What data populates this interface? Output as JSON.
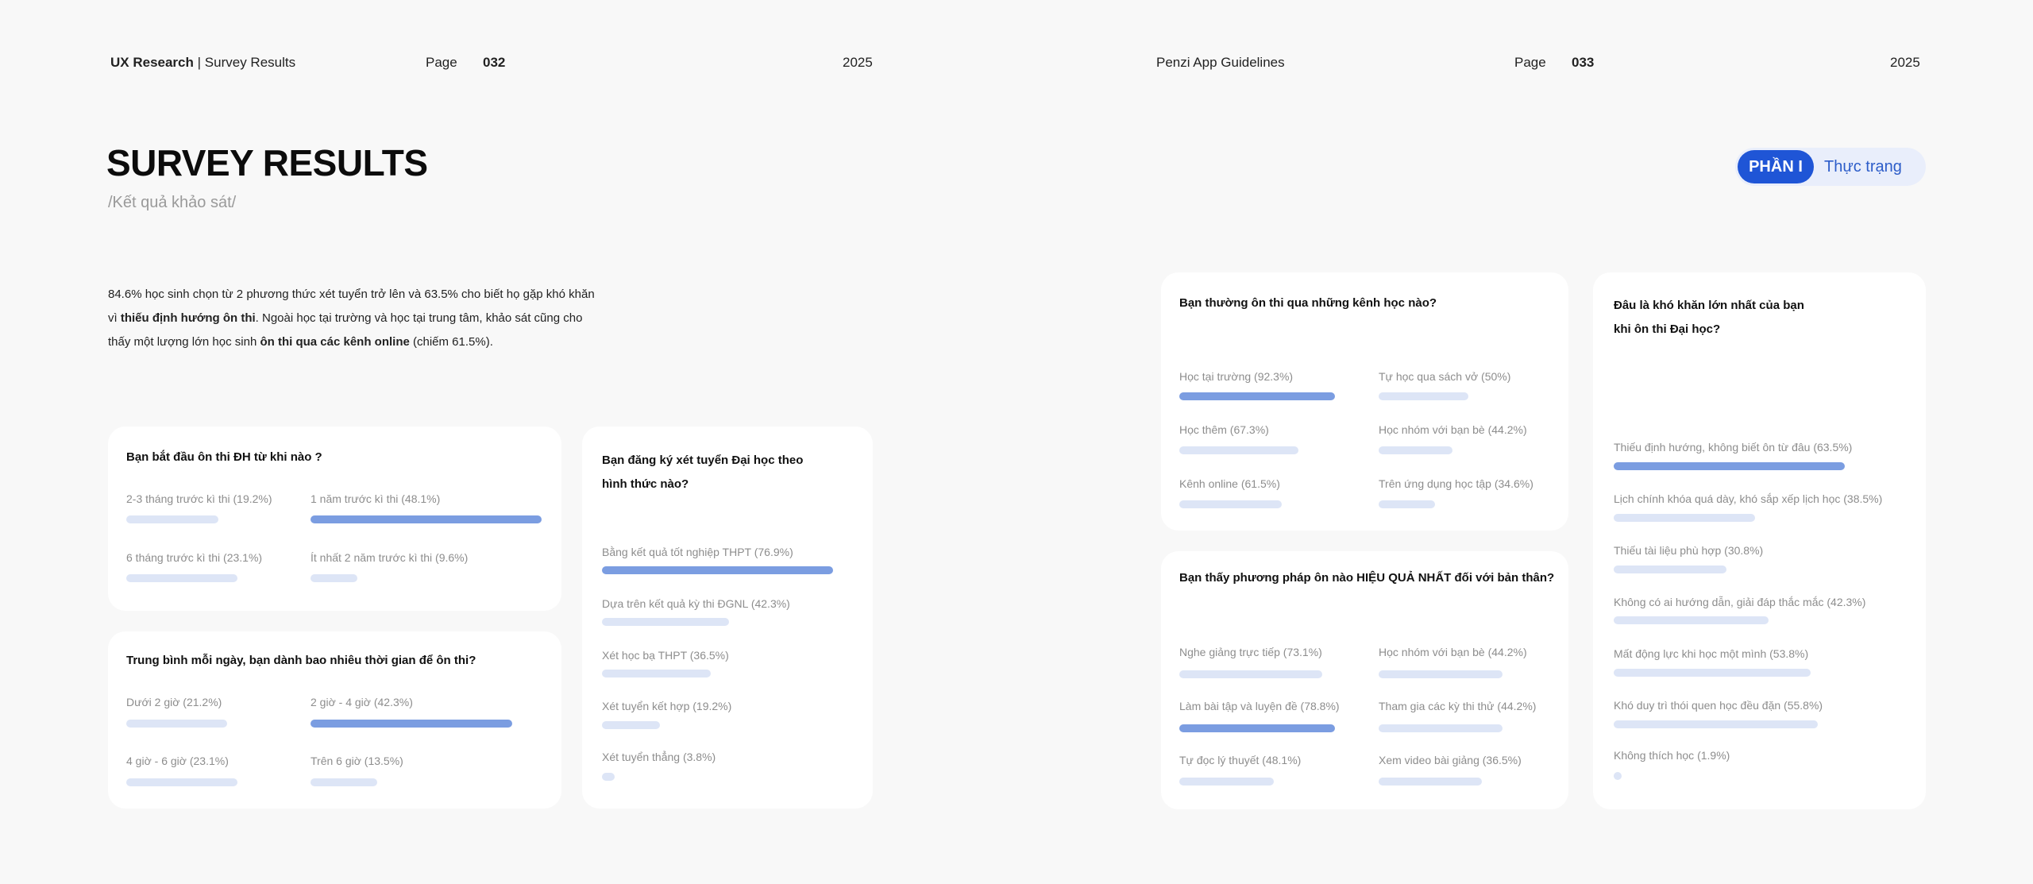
{
  "header": {
    "left_brand": "UX Research",
    "left_divider": "|",
    "left_sub": "Survey Results",
    "page_label_1": "Page",
    "page_no_1": "032",
    "year_1": "2025",
    "right_title": "Penzi App Guidelines",
    "page_label_2": "Page",
    "page_no_2": "033",
    "year_2": "2025"
  },
  "title": "SURVEY RESULTS",
  "subtitle": "/Kết quả khảo sát/",
  "intro": {
    "p1": "84.6% học sinh chọn từ 2 phương thức xét tuyển trở lên và 63.5% cho biết họ gặp khó khăn vì ",
    "b1": "thiếu định hướng ôn thi",
    "p2": ". Ngoài học tại trường và học tại trung tâm, khảo sát cũng cho thấy một lượng lớn học sinh ",
    "b2": "ôn thi qua các kênh online",
    "p3": " (chiếm 61.5%)."
  },
  "section_pill": {
    "part": "PHẦN I",
    "topic": "Thực trạng"
  },
  "colors": {
    "bar_top": "#7b9de1",
    "bar_other": "#dde5f6",
    "pill_active": "#1f55d6"
  },
  "cards": {
    "start": {
      "question": "Bạn bắt đầu ôn thi ĐH từ khi nào ?",
      "items": [
        {
          "label": "2-3 tháng trước kì thi (19.2%)",
          "value": 19.2
        },
        {
          "label": "1 năm trước kì thi (48.1%)",
          "value": 48.1
        },
        {
          "label": "6 tháng trước kì thi (23.1%)",
          "value": 23.1
        },
        {
          "label": "Ít nhất 2 năm trước kì thi (9.6%)",
          "value": 9.6
        }
      ]
    },
    "time": {
      "question": "Trung bình mỗi ngày, bạn dành bao nhiêu thời gian để ôn thi?",
      "items": [
        {
          "label": "Dưới 2 giờ (21.2%)",
          "value": 21.2
        },
        {
          "label": "2 giờ - 4 giờ (42.3%)",
          "value": 42.3
        },
        {
          "label": "4 giờ - 6 giờ (23.1%)",
          "value": 23.1
        },
        {
          "label": "Trên 6 giờ (13.5%)",
          "value": 13.5
        }
      ]
    },
    "admission": {
      "question_l1": "Bạn đăng ký xét tuyển Đại học theo",
      "question_l2": "hình thức nào?",
      "items": [
        {
          "label": "Bằng kết quả tốt nghiệp THPT (76.9%)",
          "value": 76.9
        },
        {
          "label": "Dựa trên kết quả kỳ thi ĐGNL (42.3%)",
          "value": 42.3
        },
        {
          "label": "Xét học bạ THPT (36.5%)",
          "value": 36.5
        },
        {
          "label": "Xét tuyển kết hợp  (19.2%)",
          "value": 19.2
        },
        {
          "label": "Xét tuyển thẳng (3.8%)",
          "value": 3.8
        }
      ]
    },
    "channels": {
      "question": "Bạn thường ôn thi qua những kênh học nào?",
      "items": [
        {
          "label": "Học tại trường (92.3%)",
          "value": 92.3
        },
        {
          "label": "Tự học qua sách vở (50%)",
          "value": 50
        },
        {
          "label": "Học thêm (67.3%)",
          "value": 67.3
        },
        {
          "label": "Học nhóm với bạn bè (44.2%)",
          "value": 44.2
        },
        {
          "label": "Kênh online (61.5%)",
          "value": 61.5
        },
        {
          "label": "Trên ứng dụng học tập (34.6%)",
          "value": 34.6
        }
      ]
    },
    "methods": {
      "question": "Bạn thấy phương pháp ôn nào HIỆU QUẢ NHẤT đối với bản thân?",
      "items": [
        {
          "label": "Nghe giảng trực tiếp (73.1%)",
          "value": 73.1
        },
        {
          "label": "Học nhóm với bạn bè (44.2%)",
          "value": 44.2
        },
        {
          "label": "Làm bài tập và luyện đề (78.8%)",
          "value": 78.8
        },
        {
          "label": "Tham gia các kỳ thi thử (44.2%)",
          "value": 44.2
        },
        {
          "label": "Tự đọc lý thuyết (48.1%)",
          "value": 48.1
        },
        {
          "label": "Xem video bài giảng (36.5%)",
          "value": 36.5
        }
      ]
    },
    "difficulty": {
      "question_l1": "Đâu là khó khăn lớn nhất của bạn",
      "question_l2": "khi ôn thi Đại học?",
      "items": [
        {
          "label": "Thiếu định hướng, không biết ôn từ đâu (63.5%)",
          "value": 63.5
        },
        {
          "label": "Lịch chính khóa quá dày, khó sắp xếp lịch học (38.5%)",
          "value": 38.5
        },
        {
          "label": "Thiếu tài liệu phù hợp (30.8%)",
          "value": 30.8
        },
        {
          "label": "Không có ai hướng dẫn, giải đáp thắc mắc  (42.3%)",
          "value": 42.3
        },
        {
          "label": "Mất động lực khi học một mình (53.8%)",
          "value": 53.8
        },
        {
          "label": "Khó duy trì thói quen học đều đặn (55.8%)",
          "value": 55.8
        },
        {
          "label": "Không thích học (1.9%)",
          "value": 1.9
        }
      ]
    }
  }
}
